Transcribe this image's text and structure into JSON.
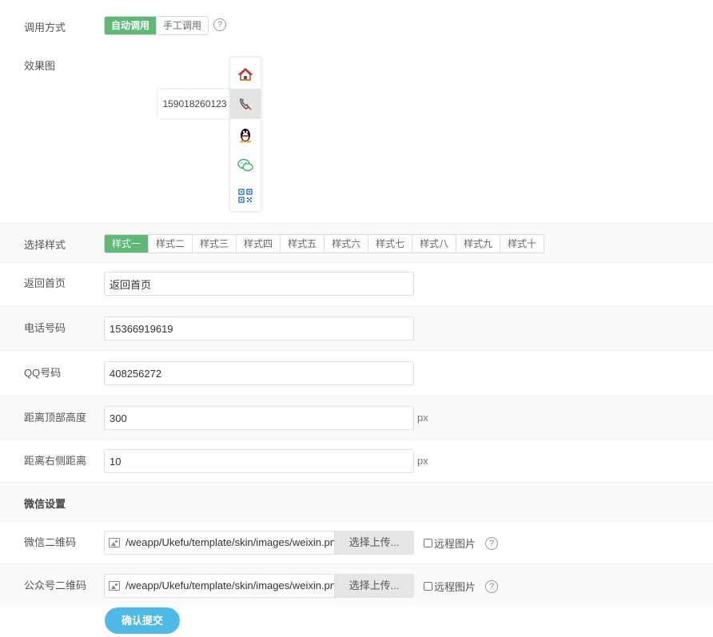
{
  "invoke": {
    "label": "调用方式",
    "options": [
      "自动调用",
      "手工调用"
    ],
    "active_index": 0,
    "help": "?"
  },
  "preview": {
    "label": "效果图",
    "phone_tip": "159018260123",
    "icons": [
      "home-icon",
      "phone-icon",
      "qq-icon",
      "wechat-icon",
      "qrcode-icon"
    ]
  },
  "style_select": {
    "label": "选择样式",
    "options": [
      "样式一",
      "样式二",
      "样式三",
      "样式四",
      "样式五",
      "样式六",
      "样式七",
      "样式八",
      "样式九",
      "样式十"
    ],
    "active_index": 0
  },
  "fields": {
    "home": {
      "label": "返回首页",
      "value": "返回首页"
    },
    "phone": {
      "label": "电话号码",
      "value": "15366919619"
    },
    "qq": {
      "label": "QQ号码",
      "value": "408256272"
    },
    "top": {
      "label": "距离顶部高度",
      "value": "300",
      "unit": "px"
    },
    "right": {
      "label": "距离右侧距离",
      "value": "10",
      "unit": "px"
    }
  },
  "wechat_section": {
    "title": "微信设置"
  },
  "uploads": {
    "wechat_qr": {
      "label": "微信二维码",
      "path": "/weapp/Ukefu/template/skin/images/weixin.png",
      "button": "选择上传...",
      "remote": "远程图片",
      "help": "?"
    },
    "mp_qr": {
      "label": "公众号二维码",
      "path": "/weapp/Ukefu/template/skin/images/weixin.png",
      "button": "选择上传...",
      "remote": "远程图片",
      "help": "?"
    }
  },
  "submit": {
    "label": "确认提交"
  },
  "colors": {
    "active": "#5fb878",
    "submit": "#4db9e4"
  }
}
